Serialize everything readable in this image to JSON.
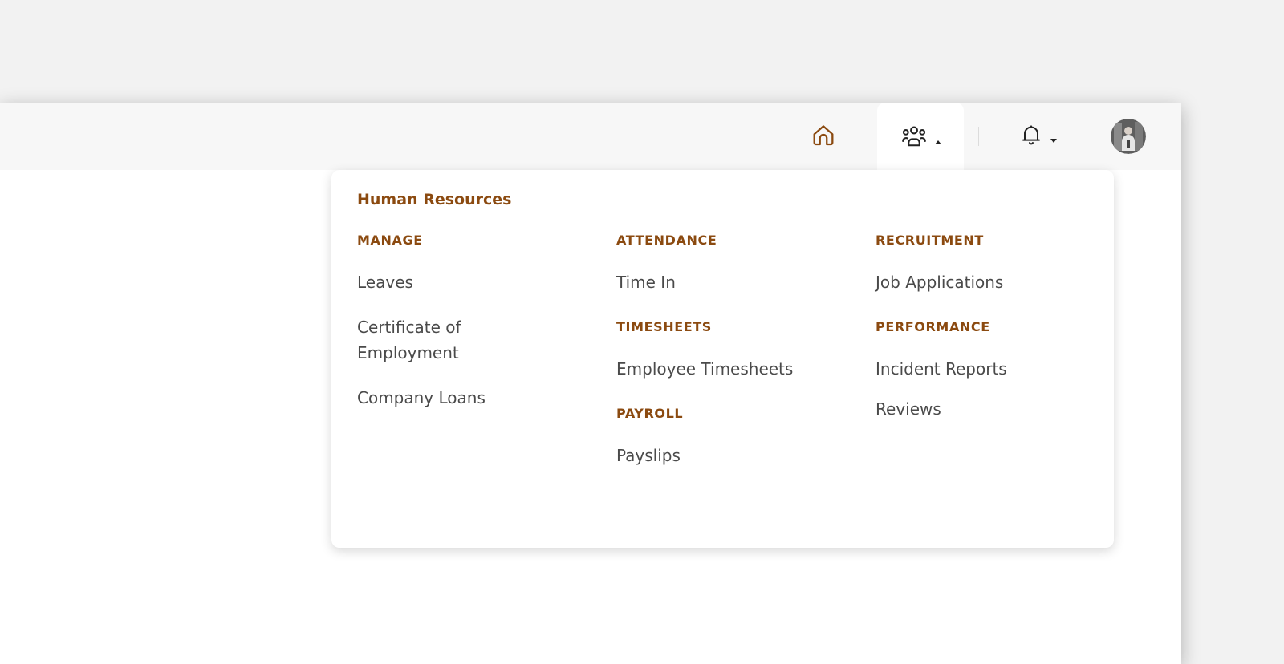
{
  "colors": {
    "accent": "#8b4a10",
    "link_text": "#4a4a4a",
    "page_background": "#f2f2f2",
    "topbar_background": "#f7f7f7"
  },
  "topbar": {
    "home_icon": "home-icon",
    "hr_icon": "people-icon",
    "notifications_icon": "bell-icon",
    "avatar": "user-avatar"
  },
  "menu": {
    "title": "Human Resources",
    "columns": [
      {
        "sections": [
          {
            "title": "MANAGE",
            "items": [
              "Leaves",
              "Certificate of Employment",
              "Company Loans"
            ]
          }
        ]
      },
      {
        "sections": [
          {
            "title": "ATTENDANCE",
            "items": [
              "Time In"
            ]
          },
          {
            "title": "TIMESHEETS",
            "items": [
              "Employee Timesheets"
            ]
          },
          {
            "title": "PAYROLL",
            "items": [
              "Payslips"
            ]
          }
        ]
      },
      {
        "sections": [
          {
            "title": "RECRUITMENT",
            "items": [
              "Job Applications"
            ]
          },
          {
            "title": "PERFORMANCE",
            "items": [
              "Incident Reports",
              "Reviews"
            ]
          }
        ]
      }
    ]
  }
}
